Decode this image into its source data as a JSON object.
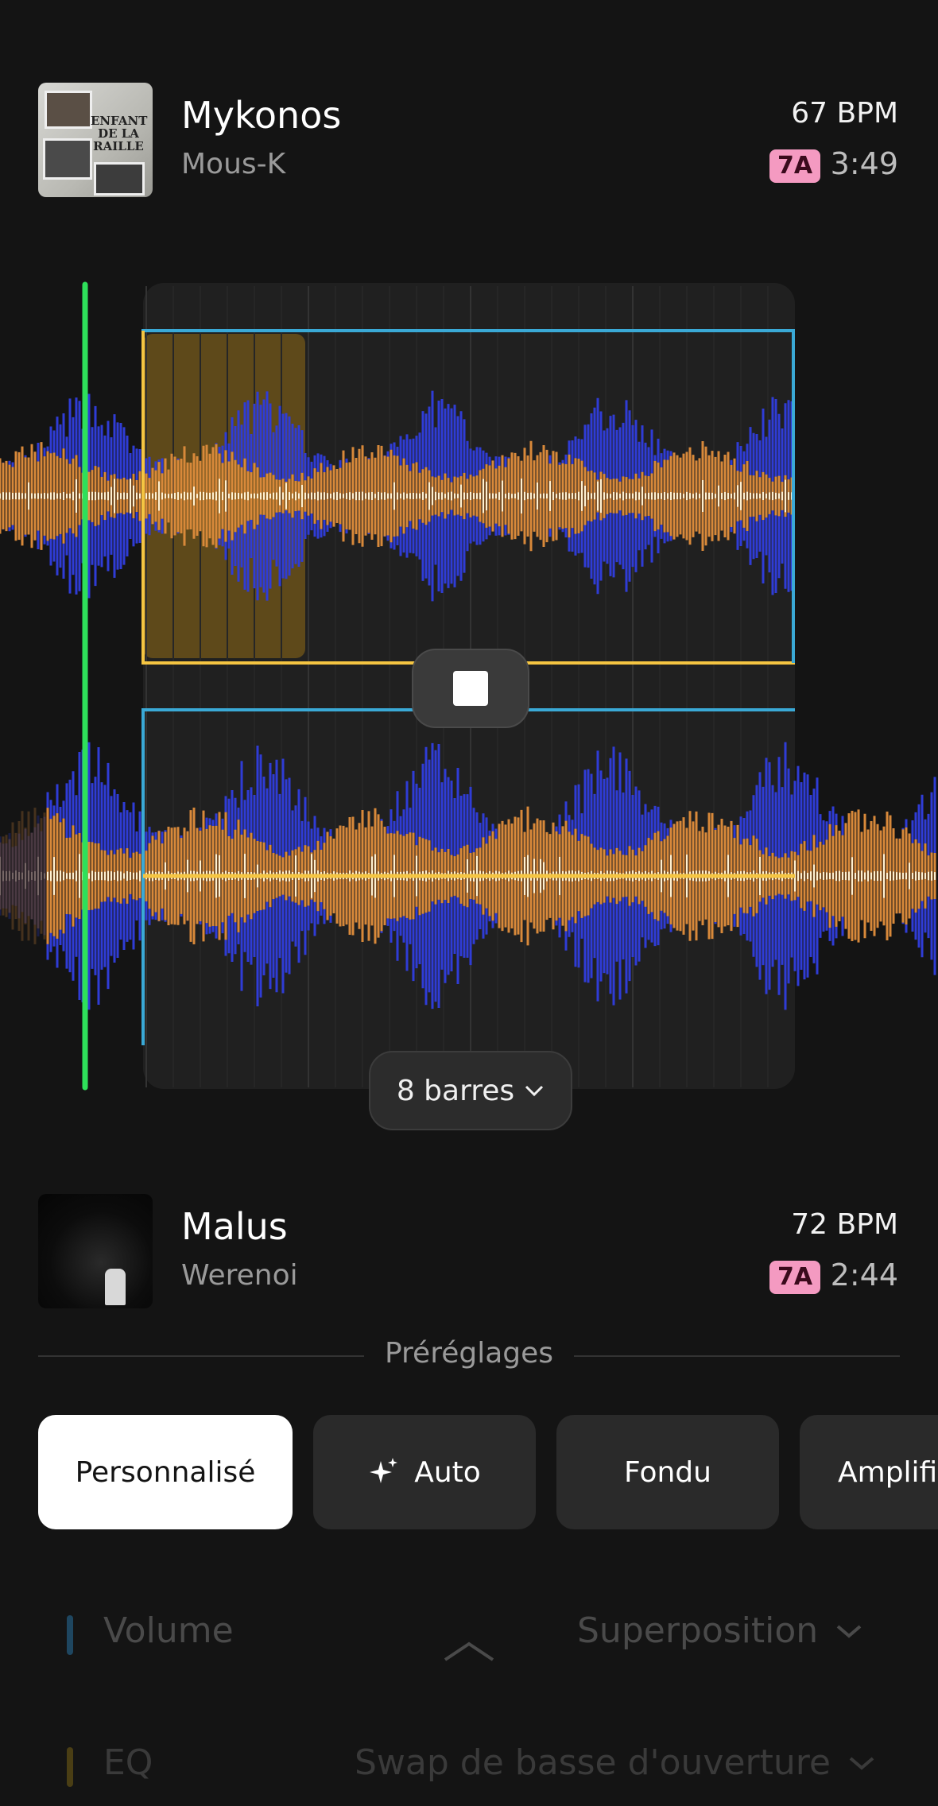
{
  "track_top": {
    "title": "Mykonos",
    "artist": "Mous-K",
    "bpm": "67 BPM",
    "key": "7A",
    "duration": "3:49",
    "cover_text": "ENFANT DE LA RAILLE"
  },
  "track_bottom": {
    "title": "Malus",
    "artist": "Werenoi",
    "bpm": "72 BPM",
    "key": "7A",
    "duration": "2:44"
  },
  "transition": {
    "bars_label": "8 barres"
  },
  "presets": {
    "title": "Préréglages",
    "items": [
      {
        "label": "Personnalisé",
        "active": true
      },
      {
        "label": "Auto",
        "active": false
      },
      {
        "label": "Fondu",
        "active": false
      },
      {
        "label": "Amplifi",
        "active": false
      }
    ]
  },
  "controls": {
    "volume_label": "Volume",
    "volume_mode": "Superposition",
    "eq_label": "EQ",
    "eq_mode": "Swap de basse d'ouverture"
  },
  "colors": {
    "playhead": "#2ee05a",
    "top_bracket": "#3aa9d6",
    "bottom_bracket": "#f5c542",
    "wave_orange": "#d8893a",
    "wave_blue": "#2f3cd6",
    "wave_white": "#fff1d2",
    "key_badge": "#f49ac1"
  }
}
